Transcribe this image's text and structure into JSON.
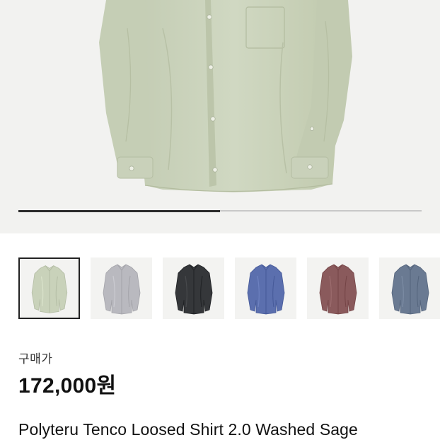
{
  "product": {
    "price_label": "구매가",
    "price": "172,000원",
    "title": "Polyteru Tenco Loosed Shirt 2.0 Washed Sage"
  },
  "gallery": {
    "progress_fraction": 0.5,
    "main_image": "washed-sage-shirt-image",
    "thumbnails": [
      {
        "name": "washed-sage",
        "color": "#c9d2ba",
        "selected": true
      },
      {
        "name": "light-gray",
        "color": "#b9b9bf",
        "selected": false
      },
      {
        "name": "black",
        "color": "#35373a",
        "selected": false
      },
      {
        "name": "blue",
        "color": "#5b6fae",
        "selected": false
      },
      {
        "name": "burgundy-brown",
        "color": "#8a5a5c",
        "selected": false
      },
      {
        "name": "slate-blue",
        "color": "#6a7a92",
        "selected": false
      }
    ]
  },
  "colors": {
    "accent": "#222222",
    "hero_bg": "#f2f2f0",
    "shirt_main": "#cbd3bd"
  }
}
